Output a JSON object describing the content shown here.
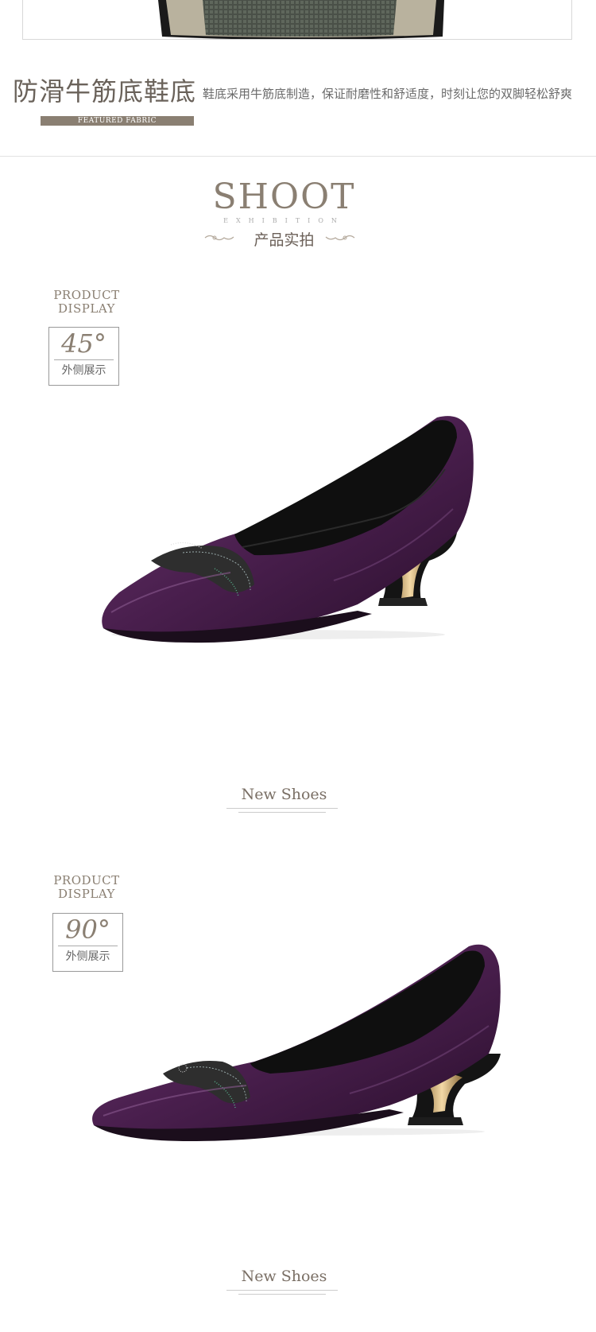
{
  "feature": {
    "title": "防滑牛筋底鞋底",
    "description": "鞋底采用牛筋底制造，保证耐磨性和舒适度，时刻让您的双脚轻松舒爽",
    "badge": "FEATURED FABRIC"
  },
  "section": {
    "title": "SHOOT",
    "subtitle": "EXHIBITION",
    "cn_title": "产品实拍"
  },
  "views": [
    {
      "label_line1": "PRODUCT",
      "label_line2": "DISPLAY",
      "angle": "45°",
      "angle_cn": "外侧展示",
      "caption": "New Shoes"
    },
    {
      "label_line1": "PRODUCT",
      "label_line2": "DISPLAY",
      "angle": "90°",
      "angle_cn": "外侧展示",
      "caption": "New Shoes"
    }
  ],
  "colors": {
    "accent": "#8a7f72",
    "shoe_purple": "#4a1f4e",
    "heel_black": "#141414",
    "gold": "#c9a46a"
  }
}
